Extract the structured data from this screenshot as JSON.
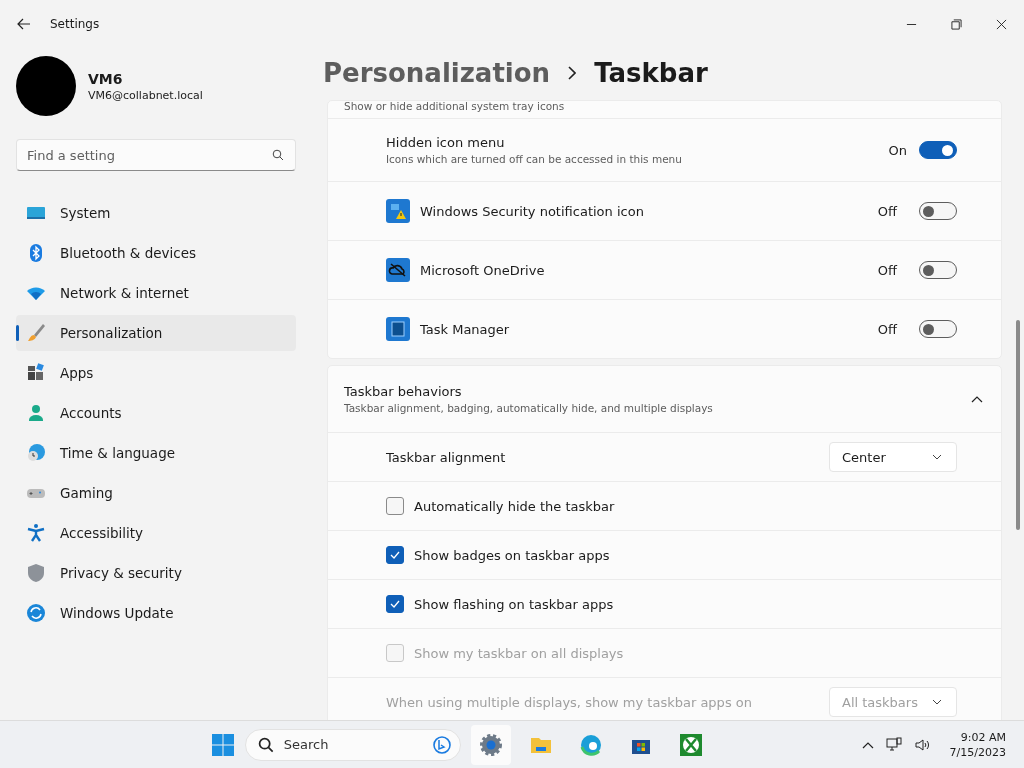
{
  "window": {
    "title": "Settings"
  },
  "user": {
    "name": "VM6",
    "email": "VM6@collabnet.local"
  },
  "search": {
    "placeholder": "Find a setting"
  },
  "nav": [
    {
      "kind": "system",
      "label": "System",
      "selected": false
    },
    {
      "kind": "bluetooth",
      "label": "Bluetooth & devices",
      "selected": false
    },
    {
      "kind": "network",
      "label": "Network & internet",
      "selected": false
    },
    {
      "kind": "personalization",
      "label": "Personalization",
      "selected": true
    },
    {
      "kind": "apps",
      "label": "Apps",
      "selected": false
    },
    {
      "kind": "accounts",
      "label": "Accounts",
      "selected": false
    },
    {
      "kind": "time",
      "label": "Time & language",
      "selected": false
    },
    {
      "kind": "gaming",
      "label": "Gaming",
      "selected": false
    },
    {
      "kind": "accessibility",
      "label": "Accessibility",
      "selected": false
    },
    {
      "kind": "privacy",
      "label": "Privacy & security",
      "selected": false
    },
    {
      "kind": "update",
      "label": "Windows Update",
      "selected": false
    }
  ],
  "breadcrumb": {
    "parent": "Personalization",
    "current": "Taskbar"
  },
  "tray": {
    "subtitle": "Show or hide additional system tray icons",
    "hidden_menu": {
      "title": "Hidden icon menu",
      "subtitle": "Icons which are turned off can be accessed in this menu",
      "state": "On",
      "on": true
    },
    "items": [
      {
        "kind": "security",
        "label": "Windows Security notification icon",
        "state": "Off",
        "on": false
      },
      {
        "kind": "onedrive",
        "label": "Microsoft OneDrive",
        "state": "Off",
        "on": false
      },
      {
        "kind": "taskmanager",
        "label": "Task Manager",
        "state": "Off",
        "on": false
      }
    ]
  },
  "behaviors": {
    "title": "Taskbar behaviors",
    "subtitle": "Taskbar alignment, badging, automatically hide, and multiple displays",
    "expanded": true,
    "settings": [
      {
        "kind": "dropdown",
        "label": "Taskbar alignment",
        "value": "Center",
        "disabled": false
      },
      {
        "kind": "checkbox",
        "label": "Automatically hide the taskbar",
        "checked": false,
        "disabled": false
      },
      {
        "kind": "checkbox",
        "label": "Show badges on taskbar apps",
        "checked": true,
        "disabled": false
      },
      {
        "kind": "checkbox",
        "label": "Show flashing on taskbar apps",
        "checked": true,
        "disabled": false
      },
      {
        "kind": "checkbox",
        "label": "Show my taskbar on all displays",
        "checked": false,
        "disabled": true
      },
      {
        "kind": "dropdown",
        "label": "When using multiple displays, show my taskbar apps on",
        "value": "All taskbars",
        "disabled": true
      }
    ]
  },
  "taskbar": {
    "search_placeholder": "Search",
    "apps": [
      {
        "kind": "settings",
        "active": true
      },
      {
        "kind": "explorer",
        "active": false
      },
      {
        "kind": "edge",
        "active": false
      },
      {
        "kind": "store",
        "active": false
      },
      {
        "kind": "xbox",
        "active": false
      }
    ],
    "time": "9:02 AM",
    "date": "7/15/2023"
  }
}
